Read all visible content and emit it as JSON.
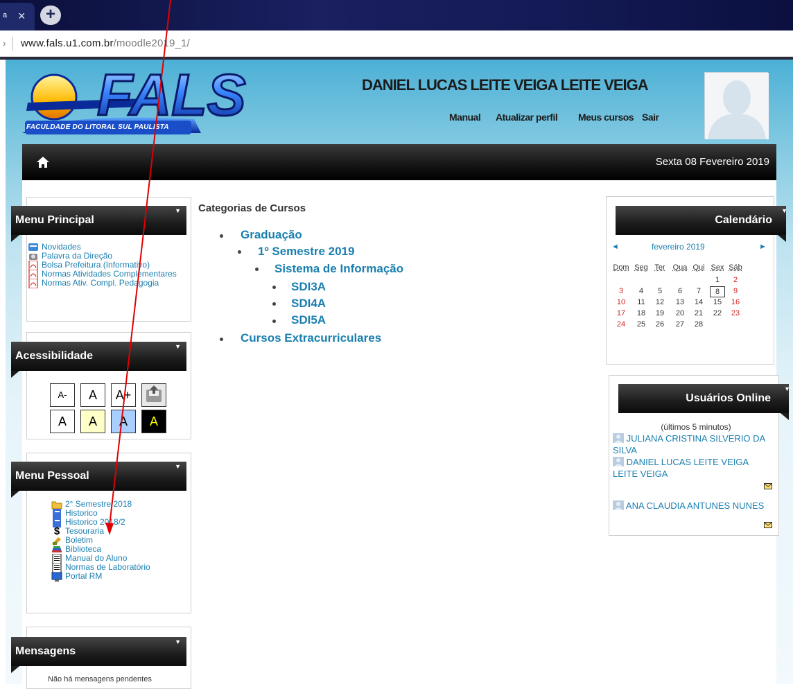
{
  "browser": {
    "tab_close": "×",
    "new_tab": "+",
    "url_host": "www.fals.u1.com.br",
    "url_path": "/moodle2019_1/"
  },
  "header": {
    "logo_text": "FALS",
    "logo_tagline": "FACULDADE DO LITORAL SUL PAULISTA",
    "user_name": "DANIEL LUCAS LEITE VEIGA LEITE VEIGA",
    "nav": [
      "Manual",
      "Atualizar perfil",
      "Meus cursos",
      "Sair"
    ]
  },
  "navbar": {
    "date": "Sexta 08 Fevereiro 2019"
  },
  "menu_principal": {
    "title": "Menu Principal",
    "items": [
      {
        "label": "Novidades",
        "icon": "news-icon"
      },
      {
        "label": "Palavra da Direção",
        "icon": "speaker-icon"
      },
      {
        "label": "Bolsa Prefeitura (Informativo)",
        "icon": "pdf-icon"
      },
      {
        "label": "Normas Atividades Complementares",
        "icon": "pdf-icon"
      },
      {
        "label": "Normas Ativ. Compl. Pedagogia",
        "icon": "pdf-icon"
      }
    ]
  },
  "acessibilidade": {
    "title": "Acessibilidade",
    "row1": [
      "A-",
      "A",
      "A+"
    ],
    "row2": [
      "A",
      "A",
      "A",
      "A"
    ]
  },
  "menu_pessoal": {
    "title": "Menu Pessoal",
    "items": [
      {
        "label": "2° Semestre 2018",
        "icon": "folder-icon"
      },
      {
        "label": "Historico",
        "icon": "notebook-icon"
      },
      {
        "label": "Historico 2018/2",
        "icon": "notebook-icon"
      },
      {
        "label": "Tesouraria",
        "icon": "dollar-icon"
      },
      {
        "label": "Boletim",
        "icon": "pencil-icon"
      },
      {
        "label": "Biblioteca",
        "icon": "books-icon"
      },
      {
        "label": "Manual do Aluno",
        "icon": "document-icon"
      },
      {
        "label": "Normas de Laboratório",
        "icon": "document-icon"
      },
      {
        "label": "Portal RM",
        "icon": "monitor-icon"
      }
    ]
  },
  "mensagens": {
    "title": "Mensagens",
    "text": "Não há mensagens pendentes"
  },
  "categorias": {
    "title": "Categorias de Cursos",
    "graduacao": "Graduação",
    "semestre": "1º Semestre 2019",
    "sistema": "Sistema de Informação",
    "turmas": [
      "SDI3A",
      "SDI4A",
      "SDI5A"
    ],
    "extra": "Cursos Extracurriculares"
  },
  "calendario": {
    "title": "Calendário",
    "month": "fevereiro 2019",
    "prev": "◄",
    "next": "►",
    "weekdays": [
      "Dom",
      "Seg",
      "Ter",
      "Qua",
      "Qui",
      "Sex",
      "Sáb"
    ],
    "weeks": [
      [
        "",
        "",
        "",
        "",
        "",
        "1",
        "2"
      ],
      [
        "3",
        "4",
        "5",
        "6",
        "7",
        "8",
        "9"
      ],
      [
        "10",
        "11",
        "12",
        "13",
        "14",
        "15",
        "16"
      ],
      [
        "17",
        "18",
        "19",
        "20",
        "21",
        "22",
        "23"
      ],
      [
        "24",
        "25",
        "26",
        "27",
        "28",
        "",
        ""
      ]
    ],
    "today": "8"
  },
  "online": {
    "title": "Usuários Online",
    "subtitle": "(últimos 5 minutos)",
    "users": [
      "JULIANA CRISTINA SILVERIO DA SILVA",
      "DANIEL LUCAS LEITE VEIGA LEITE VEIGA",
      "ANA CLAUDIA ANTUNES NUNES"
    ]
  },
  "colors": {
    "link": "#1a7fb0",
    "annotation_arrow": "#e00000"
  }
}
